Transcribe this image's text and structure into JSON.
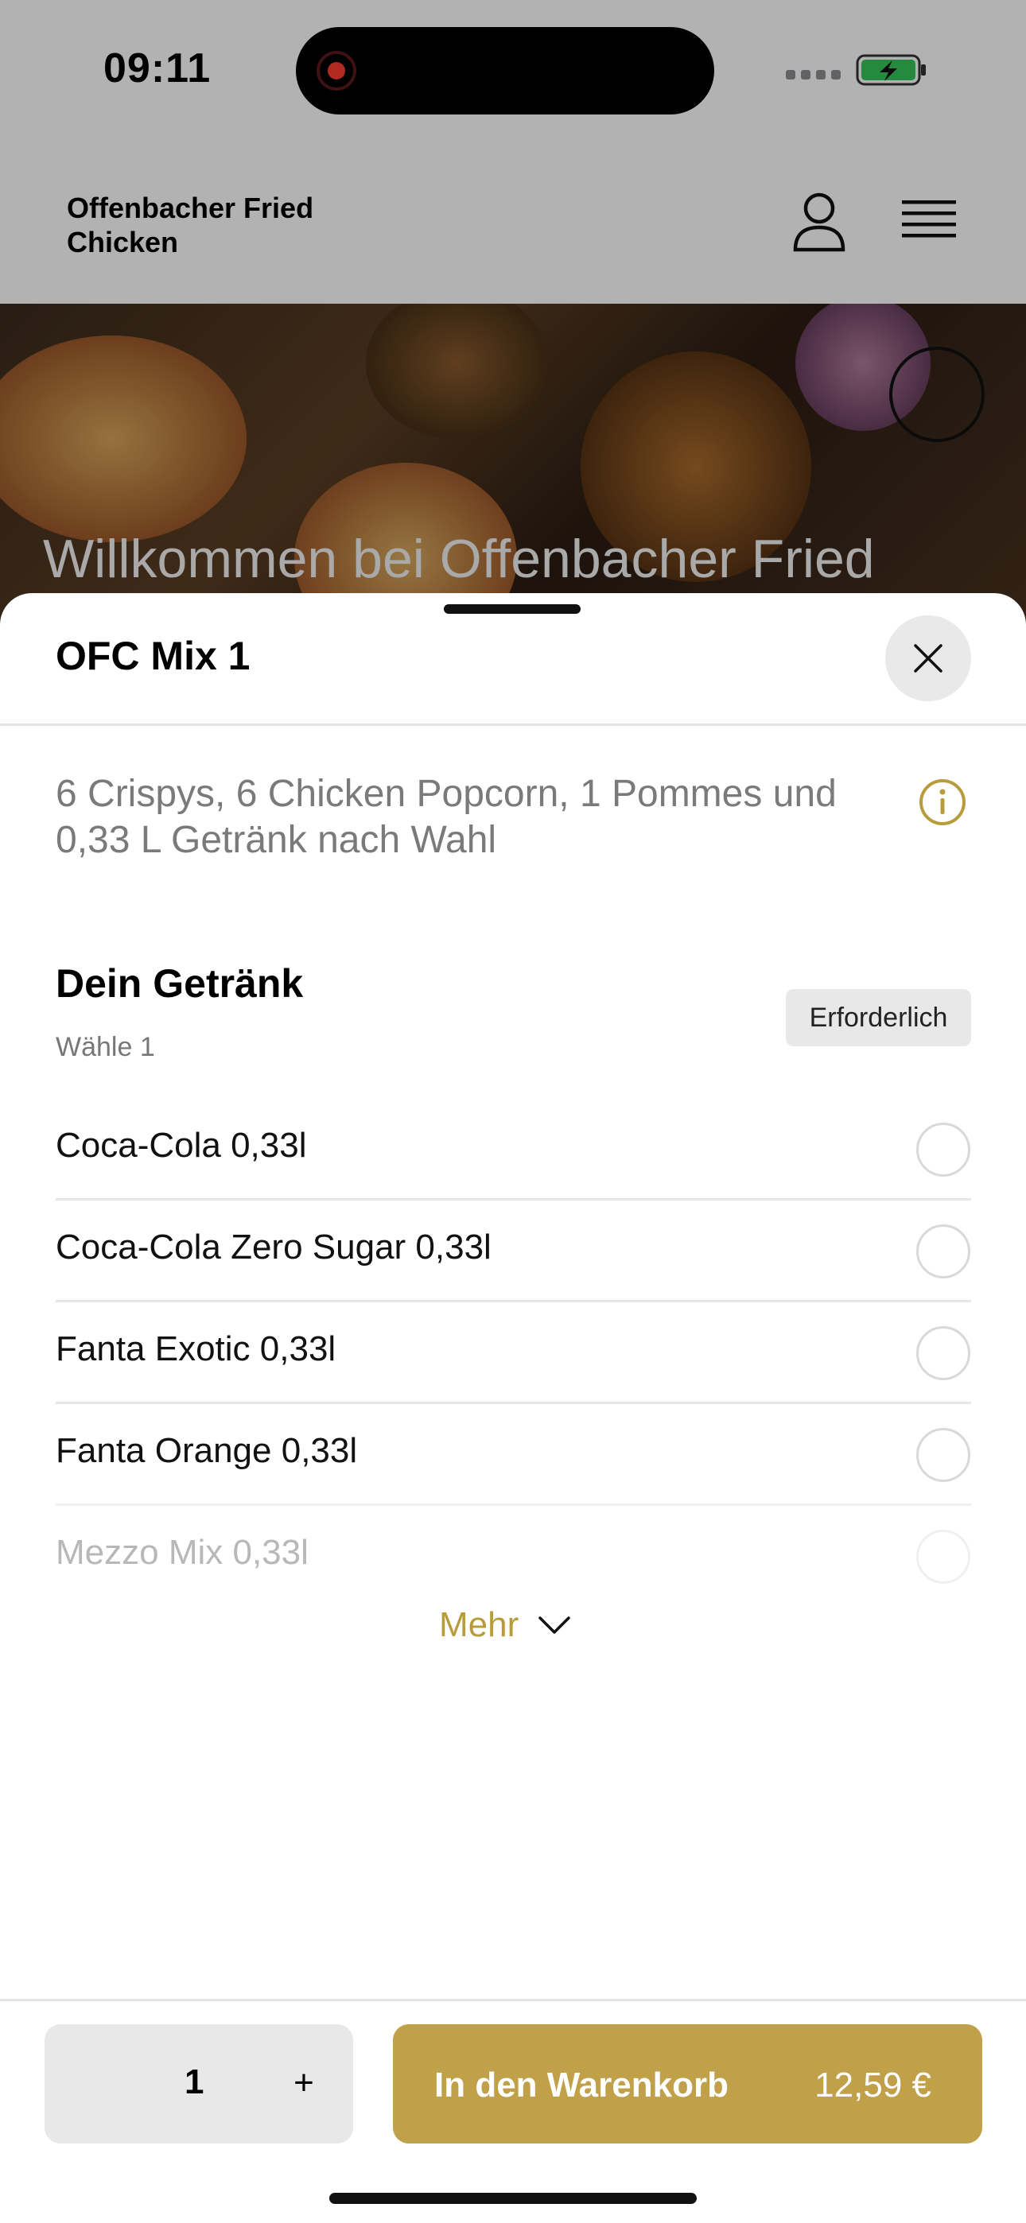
{
  "status_bar": {
    "time": "09:11"
  },
  "header": {
    "brand": "Offenbacher Fried Chicken"
  },
  "hero": {
    "title": "Willkommen bei Offenbacher Fried"
  },
  "sheet": {
    "title": "OFC Mix 1",
    "description": "6 Crispys, 6 Chicken Popcorn, 1 Pommes und 0,33 L Getränk nach Wahl"
  },
  "group": {
    "title": "Dein Getränk",
    "subtitle": "Wähle 1",
    "badge": "Erforderlich",
    "options": [
      {
        "label": "Coca-Cola 0,33l"
      },
      {
        "label": "Coca-Cola Zero Sugar 0,33l"
      },
      {
        "label": "Fanta Exotic 0,33l"
      },
      {
        "label": "Fanta Orange 0,33l"
      },
      {
        "label": "Mezzo Mix 0,33l"
      }
    ],
    "more_label": "Mehr"
  },
  "footer": {
    "quantity": "1",
    "plus_label": "+",
    "cart_label": "In den Warenkorb",
    "price": "12,59 €"
  },
  "colors": {
    "accent": "#c1a04a",
    "accent_text": "#b89c3c",
    "battery": "#34c759"
  }
}
